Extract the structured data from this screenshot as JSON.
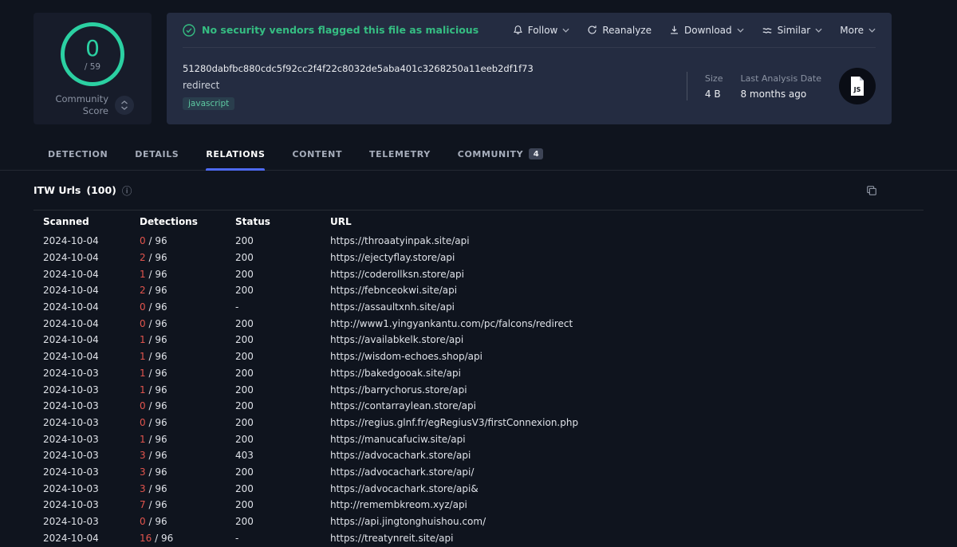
{
  "header": {
    "score": {
      "value": "0",
      "denominator": "/ 59",
      "label": "Community Score"
    },
    "verdict": "No security vendors flagged this file as malicious",
    "actions": [
      {
        "label": "Follow",
        "icon": "bell",
        "chevron": true
      },
      {
        "label": "Reanalyze",
        "icon": "refresh",
        "chevron": false
      },
      {
        "label": "Download",
        "icon": "download",
        "chevron": true
      },
      {
        "label": "Similar",
        "icon": "similar",
        "chevron": true
      },
      {
        "label": "More",
        "icon": "",
        "chevron": true
      }
    ],
    "hash": "51280dabfbc880cdc5f92cc2f4f22c8032de5aba401c3268250a11eeb2df1f73",
    "filename": "redirect",
    "tags": [
      "javascript"
    ],
    "meta": [
      {
        "label": "Size",
        "value": "4 B"
      },
      {
        "label": "Last Analysis Date",
        "value": "8 months ago"
      }
    ],
    "filetype": "JS"
  },
  "tabs": [
    {
      "label": "DETECTION",
      "active": false
    },
    {
      "label": "DETAILS",
      "active": false
    },
    {
      "label": "RELATIONS",
      "active": true
    },
    {
      "label": "CONTENT",
      "active": false
    },
    {
      "label": "TELEMETRY",
      "active": false
    },
    {
      "label": "COMMUNITY",
      "active": false,
      "badge": "4"
    }
  ],
  "relations": {
    "title": "ITW Urls",
    "count": "(100)",
    "columns": [
      "Scanned",
      "Detections",
      "Status",
      "URL"
    ],
    "rows": [
      {
        "scanned": "2024-10-04",
        "detections": "0",
        "total": "96",
        "status": "200",
        "url": "https://throaatyinpak.site/api"
      },
      {
        "scanned": "2024-10-04",
        "detections": "2",
        "total": "96",
        "status": "200",
        "url": "https://ejectyflay.store/api"
      },
      {
        "scanned": "2024-10-04",
        "detections": "1",
        "total": "96",
        "status": "200",
        "url": "https://coderollksn.store/api"
      },
      {
        "scanned": "2024-10-04",
        "detections": "2",
        "total": "96",
        "status": "200",
        "url": "https://febnceokwi.site/api"
      },
      {
        "scanned": "2024-10-04",
        "detections": "0",
        "total": "96",
        "status": "-",
        "url": "https://assaultxnh.site/api"
      },
      {
        "scanned": "2024-10-04",
        "detections": "0",
        "total": "96",
        "status": "200",
        "url": "http://www1.yingyankantu.com/pc/falcons/redirect"
      },
      {
        "scanned": "2024-10-04",
        "detections": "1",
        "total": "96",
        "status": "200",
        "url": "https://availabkelk.store/api"
      },
      {
        "scanned": "2024-10-04",
        "detections": "1",
        "total": "96",
        "status": "200",
        "url": "https://wisdom-echoes.shop/api"
      },
      {
        "scanned": "2024-10-03",
        "detections": "1",
        "total": "96",
        "status": "200",
        "url": "https://bakedgooak.site/api"
      },
      {
        "scanned": "2024-10-03",
        "detections": "1",
        "total": "96",
        "status": "200",
        "url": "https://barrychorus.store/api"
      },
      {
        "scanned": "2024-10-03",
        "detections": "0",
        "total": "96",
        "status": "200",
        "url": "https://contarraylean.store/api"
      },
      {
        "scanned": "2024-10-03",
        "detections": "0",
        "total": "96",
        "status": "200",
        "url": "https://regius.glnf.fr/egRegiusV3/firstConnexion.php"
      },
      {
        "scanned": "2024-10-03",
        "detections": "1",
        "total": "96",
        "status": "200",
        "url": "https://manucafuciw.site/api"
      },
      {
        "scanned": "2024-10-03",
        "detections": "3",
        "total": "96",
        "status": "403",
        "url": "https://advocachark.store/api"
      },
      {
        "scanned": "2024-10-03",
        "detections": "3",
        "total": "96",
        "status": "200",
        "url": "https://advocachark.store/api/"
      },
      {
        "scanned": "2024-10-03",
        "detections": "3",
        "total": "96",
        "status": "200",
        "url": "https://advocachark.store/api&"
      },
      {
        "scanned": "2024-10-03",
        "detections": "7",
        "total": "96",
        "status": "200",
        "url": "http://remembkreom.xyz/api"
      },
      {
        "scanned": "2024-10-03",
        "detections": "0",
        "total": "96",
        "status": "200",
        "url": "https://api.jingtonghuishou.com/"
      },
      {
        "scanned": "2024-10-04",
        "detections": "16",
        "total": "96",
        "status": "-",
        "url": "https://treatynreit.site/api"
      }
    ]
  },
  "colors": {
    "accent_green": "#2bd0a2",
    "verdict_green": "#35bd82",
    "danger_red": "#e2544d",
    "tab_active_blue": "#4e6af3"
  }
}
